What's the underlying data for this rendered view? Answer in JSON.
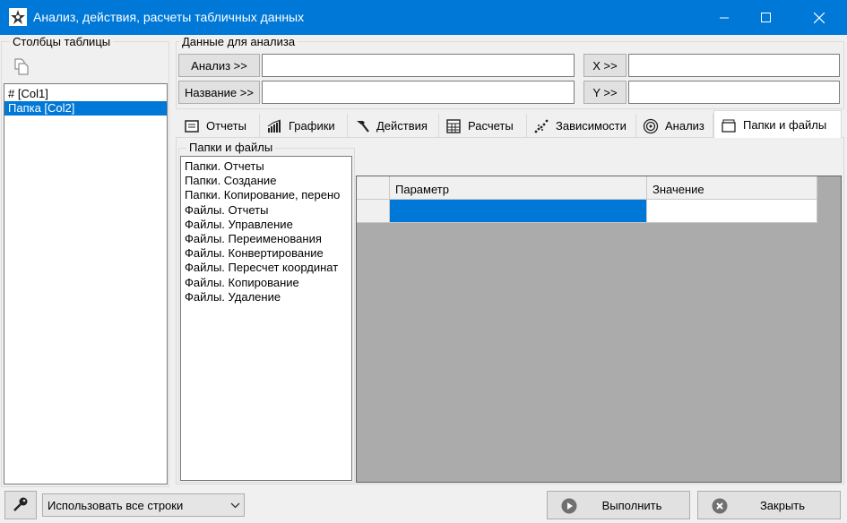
{
  "window": {
    "title": "Анализ, действия, расчеты табличных данных",
    "minimize": "—",
    "maximize": "☐",
    "close": "✕"
  },
  "left_panel": {
    "title": "Столбцы таблицы",
    "columns": [
      "# [Col1]",
      "Папка [Col2]"
    ],
    "selected_index": 1
  },
  "analysis_data": {
    "title": "Данные для анализа",
    "analysis_button": "Анализ >>",
    "name_button": "Название >>",
    "x_button": "X >>",
    "y_button": "Y >>",
    "analysis_value": "",
    "name_value": "",
    "x_value": "",
    "y_value": ""
  },
  "tabs": [
    {
      "label": "Отчеты",
      "icon": "reports-icon"
    },
    {
      "label": "Графики",
      "icon": "chart-icon"
    },
    {
      "label": "Действия",
      "icon": "hammer-icon"
    },
    {
      "label": "Расчеты",
      "icon": "calculator-icon"
    },
    {
      "label": "Зависимости",
      "icon": "scatter-icon"
    },
    {
      "label": "Анализ",
      "icon": "target-icon"
    },
    {
      "label": "Папки и файлы",
      "icon": "folder-files-icon",
      "active": true
    }
  ],
  "folders_panel": {
    "title": "Папки и файлы",
    "items": [
      "Папки. Отчеты",
      "Папки. Создание",
      "Папки. Копирование, перено",
      "Файлы. Отчеты",
      "Файлы. Управление",
      "Файлы. Переименования",
      "Файлы. Конвертирование",
      "Файлы. Пересчет координат",
      "Файлы. Копирование",
      "Файлы. Удаление"
    ]
  },
  "grid": {
    "columns": [
      "Параметр",
      "Значение"
    ],
    "rows": [
      [
        "",
        ""
      ]
    ]
  },
  "bottom": {
    "rows_option": "Использовать все строки",
    "run_button": "Выполнить",
    "close_button": "Закрыть"
  },
  "colors": {
    "titlebar": "#0078d7",
    "selection": "#0078d7"
  }
}
